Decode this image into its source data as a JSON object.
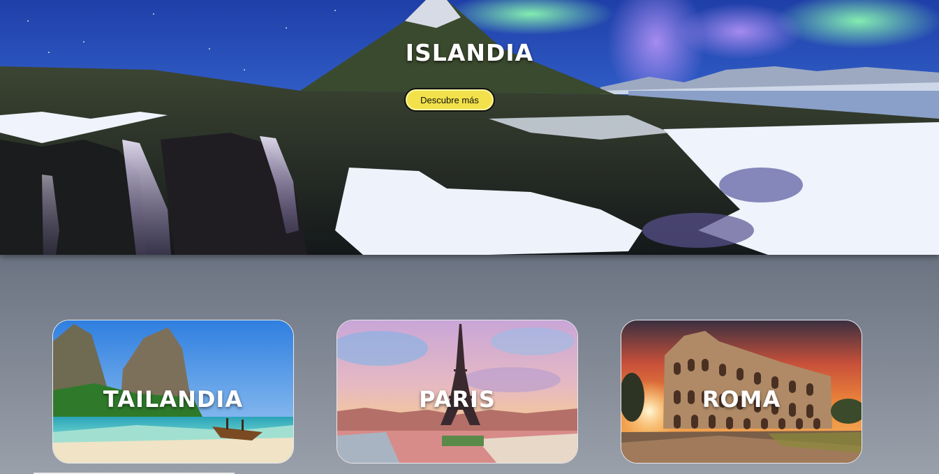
{
  "hero": {
    "title": "ISLANDIA",
    "button_label": "Descubre más"
  },
  "destinations": [
    {
      "name": "TAILANDIA"
    },
    {
      "name": "PARIS"
    },
    {
      "name": "ROMA"
    }
  ],
  "colors": {
    "button_bg": "#f2e14a",
    "page_bg_top": "#454f5f",
    "page_bg_bottom": "#9aa0aa"
  }
}
